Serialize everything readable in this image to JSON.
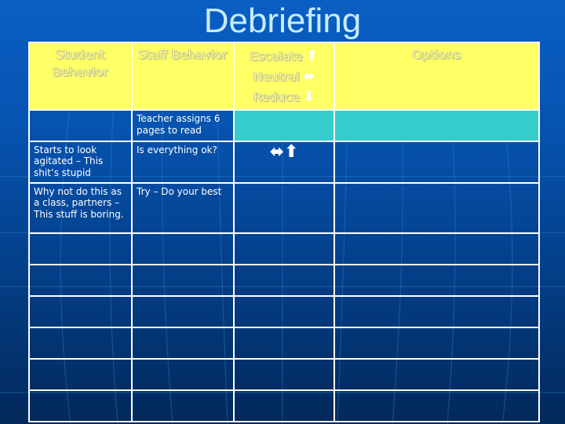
{
  "slide": {
    "title": "Debriefing"
  },
  "table": {
    "headers": {
      "student_behavior": "Student Behavior",
      "staff_behavior": "Staff Behavior",
      "scale": [
        {
          "label": "Escalate",
          "icon": "arrow-up-icon",
          "glyph": "⬆"
        },
        {
          "label": "Neutral",
          "icon": "arrow-left-right-icon",
          "glyph": "⬌"
        },
        {
          "label": "Reduce",
          "icon": "arrow-down-icon",
          "glyph": "⬇"
        }
      ],
      "options": "Options"
    },
    "teacher_row": {
      "student": "",
      "staff": "Teacher assigns 6 pages to read",
      "scale": "",
      "options": ""
    },
    "rows": [
      {
        "student": "Starts to look agitated – This shit’s stupid",
        "staff": "Is everything ok?",
        "scale_icons": [
          "⬌",
          "⬆"
        ],
        "options": ""
      },
      {
        "student": "Why not do this as a class, partners – This stuff is boring.",
        "staff": "Try – Do your best",
        "scale_icons": [],
        "options": ""
      }
    ],
    "empty_row_count": 6
  },
  "colors": {
    "header_bg": "#ffff66",
    "teacher_highlight": "#36cccc",
    "grid_lines": "#ffffff",
    "background_top": "#0a5fc4",
    "background_bottom": "#02295a"
  }
}
